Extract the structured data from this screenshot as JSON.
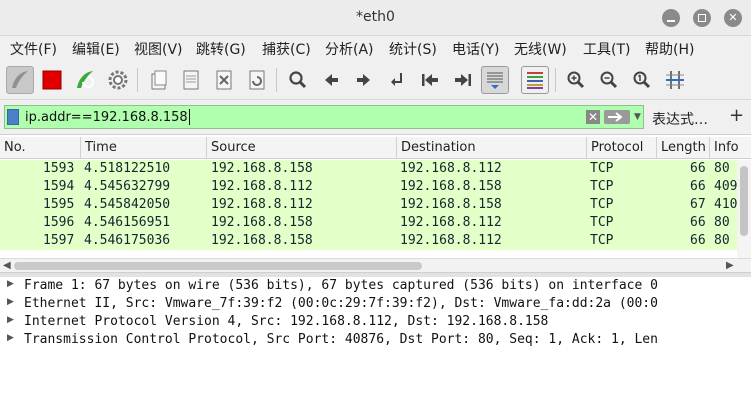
{
  "window": {
    "title": "*eth0"
  },
  "menu": [
    {
      "label": "文件(F)"
    },
    {
      "label": "编辑(E)"
    },
    {
      "label": "视图(V)"
    },
    {
      "label": "跳转(G)"
    },
    {
      "label": "捕获(C)"
    },
    {
      "label": "分析(A)"
    },
    {
      "label": "统计(S)"
    },
    {
      "label": "电话(Y)"
    },
    {
      "label": "无线(W)"
    },
    {
      "label": "工具(T)"
    },
    {
      "label": "帮助(H)"
    }
  ],
  "toolbar": {
    "icons": [
      "start-capture-icon",
      "stop-capture-icon",
      "restart-capture-icon",
      "capture-options-icon",
      "open-file-icon",
      "save-file-icon",
      "close-file-icon",
      "reload-file-icon",
      "find-packet-icon",
      "go-back-icon",
      "go-forward-icon",
      "go-to-packet-icon",
      "first-packet-icon",
      "last-packet-icon",
      "autoscroll-icon",
      "colorize-icon",
      "zoom-in-icon",
      "zoom-out-icon",
      "normal-size-icon",
      "resize-columns-icon"
    ]
  },
  "filter": {
    "value": "ip.addr==192.168.8.158",
    "expression_label": "表达式…",
    "add_label": "+"
  },
  "packet_list": {
    "columns": [
      "No.",
      "Time",
      "Source",
      "Destination",
      "Protocol",
      "Length",
      "Info"
    ],
    "rows": [
      {
        "no": "1593",
        "time": "4.518122510",
        "source": "192.168.8.158",
        "destination": "192.168.8.112",
        "protocol": "TCP",
        "length": "66",
        "info": "80"
      },
      {
        "no": "1594",
        "time": "4.545632799",
        "source": "192.168.8.112",
        "destination": "192.168.8.158",
        "protocol": "TCP",
        "length": "66",
        "info": "409"
      },
      {
        "no": "1595",
        "time": "4.545842050",
        "source": "192.168.8.112",
        "destination": "192.168.8.158",
        "protocol": "TCP",
        "length": "67",
        "info": "410"
      },
      {
        "no": "1596",
        "time": "4.546156951",
        "source": "192.168.8.158",
        "destination": "192.168.8.112",
        "protocol": "TCP",
        "length": "66",
        "info": "80"
      },
      {
        "no": "1597",
        "time": "4.546175036",
        "source": "192.168.8.158",
        "destination": "192.168.8.112",
        "protocol": "TCP",
        "length": "66",
        "info": "80"
      }
    ],
    "row_color": "#e4ffc7"
  },
  "details": [
    {
      "text": "Frame 1: 67 bytes on wire (536 bits), 67 bytes captured (536 bits) on interface 0"
    },
    {
      "text": "Ethernet II, Src: Vmware_7f:39:f2 (00:0c:29:7f:39:f2), Dst: Vmware_fa:dd:2a (00:0"
    },
    {
      "text": "Internet Protocol Version 4, Src: 192.168.8.112, Dst: 192.168.8.158"
    },
    {
      "text": "Transmission Control Protocol, Src Port: 40876, Dst Port: 80, Seq: 1, Ack: 1, Len"
    }
  ]
}
